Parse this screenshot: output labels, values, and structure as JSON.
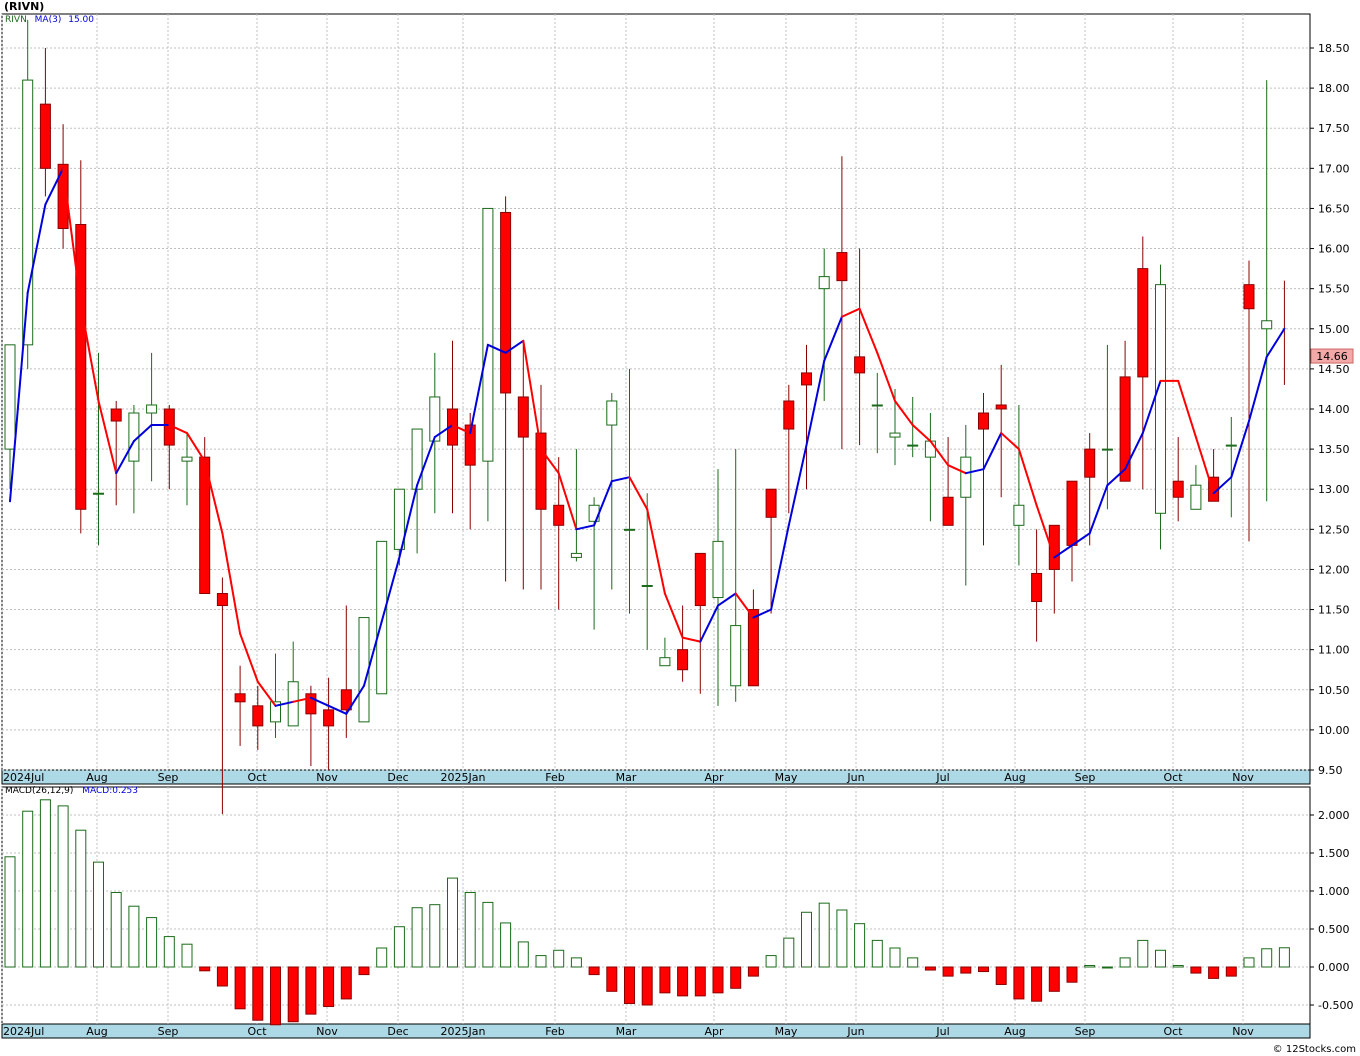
{
  "header": {
    "title": "(RIVN)"
  },
  "price_panel": {
    "legend_symbol": "RIVN",
    "legend_ma": "MA(3)",
    "legend_ma_value": "15.00",
    "last_price_label": "14.66",
    "last_price_value": 14.66,
    "y_ticks": [
      "18.50",
      "18.00",
      "17.50",
      "17.00",
      "16.50",
      "16.00",
      "15.50",
      "15.00",
      "14.50",
      "14.00",
      "13.50",
      "13.00",
      "12.50",
      "12.00",
      "11.50",
      "11.00",
      "10.50",
      "10.00",
      "9.50"
    ],
    "ylim": [
      9.5,
      18.5
    ]
  },
  "macd_panel": {
    "legend_name": "MACD(26,12,9)",
    "legend_value": "MACD:0.253",
    "y_ticks": [
      "2.000",
      "1.500",
      "1.000",
      "0.500",
      "0.000",
      "-0.500"
    ],
    "ylim": [
      -0.75,
      2.25
    ]
  },
  "x_labels": [
    "2024Jul",
    "Aug",
    "Sep",
    "Oct",
    "Nov",
    "Dec",
    "2025Jan",
    "Feb",
    "Mar",
    "Apr",
    "May",
    "Jun",
    "Jul",
    "Aug",
    "Sep",
    "Oct",
    "Nov"
  ],
  "footer": {
    "copyright": "© 12Stocks.com"
  },
  "colors": {
    "up": "#1a6b1a",
    "down": "#ff0000",
    "wick_down": "#8b0000",
    "ma_up": "#0000dd",
    "ma_down": "#ff0000",
    "grid": "#c0c0c0",
    "axis_band": "#add8e6"
  },
  "chart_data": {
    "type": "candlestick",
    "title": "(RIVN)",
    "x": [
      "2024-06-28",
      "2024-07-05",
      "2024-07-12",
      "2024-07-19",
      "2024-07-26",
      "2024-08-02",
      "2024-08-09",
      "2024-08-16",
      "2024-08-23",
      "2024-08-30",
      "2024-09-06",
      "2024-09-13",
      "2024-09-20",
      "2024-09-27",
      "2024-10-04",
      "2024-10-11",
      "2024-10-18",
      "2024-10-25",
      "2024-11-01",
      "2024-11-08",
      "2024-11-15",
      "2024-11-22",
      "2024-11-29",
      "2024-12-06",
      "2024-12-13",
      "2024-12-20",
      "2024-12-27",
      "2025-01-03",
      "2025-01-10",
      "2025-01-17",
      "2025-01-24",
      "2025-01-31",
      "2025-02-07",
      "2025-02-14",
      "2025-02-21",
      "2025-02-28",
      "2025-03-07",
      "2025-03-14",
      "2025-03-21",
      "2025-03-28",
      "2025-04-04",
      "2025-04-11",
      "2025-04-18",
      "2025-04-25",
      "2025-05-02",
      "2025-05-09",
      "2025-05-16",
      "2025-05-23",
      "2025-05-30",
      "2025-06-06",
      "2025-06-13",
      "2025-06-20",
      "2025-06-27",
      "2025-07-03",
      "2025-07-11",
      "2025-07-18",
      "2025-07-25",
      "2025-08-01",
      "2025-08-08",
      "2025-08-15",
      "2025-08-22",
      "2025-08-29",
      "2025-09-05",
      "2025-09-12",
      "2025-09-19",
      "2025-09-26",
      "2025-10-03",
      "2025-10-10",
      "2025-10-17",
      "2025-10-24",
      "2025-10-31",
      "2025-11-07",
      "2025-11-14"
    ],
    "series": [
      {
        "name": "RIVN",
        "open": [
          13.5,
          14.8,
          17.8,
          17.05,
          16.3,
          12.95,
          14.0,
          13.35,
          13.95,
          14.0,
          13.35,
          13.4,
          11.7,
          10.45,
          10.3,
          10.1,
          10.05,
          10.45,
          10.25,
          10.5,
          10.1,
          10.45,
          12.25,
          13.0,
          13.6,
          14.0,
          13.8,
          13.35,
          16.45,
          14.15,
          13.7,
          12.8,
          12.15,
          12.6,
          13.8,
          12.5,
          11.8,
          10.8,
          11.0,
          12.2,
          11.65,
          10.55,
          11.5,
          13.0,
          14.1,
          14.45,
          15.5,
          15.95,
          14.65,
          14.05,
          13.65,
          13.55,
          13.4,
          12.9,
          12.9,
          13.95,
          14.05,
          12.55,
          11.95,
          12.55,
          13.1,
          13.5,
          13.5,
          14.4,
          15.75,
          12.7,
          13.1,
          12.75,
          13.15,
          13.55,
          15.55,
          15.0
        ],
        "high": [
          14.6,
          18.85,
          18.5,
          17.55,
          17.1,
          14.7,
          14.1,
          14.05,
          14.7,
          14.05,
          13.7,
          13.65,
          11.9,
          10.8,
          10.55,
          10.95,
          11.1,
          10.55,
          10.65,
          11.55,
          10.4,
          10.8,
          12.65,
          13.6,
          14.7,
          14.85,
          13.95,
          14.3,
          16.65,
          14.85,
          14.3,
          13.4,
          13.5,
          12.9,
          14.2,
          14.5,
          12.95,
          11.15,
          11.55,
          11.95,
          13.25,
          13.5,
          11.75,
          12.65,
          14.3,
          14.8,
          16.0,
          17.15,
          16.0,
          14.45,
          14.25,
          14.15,
          13.95,
          13.65,
          13.8,
          14.2,
          14.55,
          14.05,
          12.5,
          12.3,
          13.1,
          13.7,
          14.8,
          14.85,
          16.15,
          15.8,
          13.65,
          13.3,
          13.5,
          13.9,
          15.85,
          18.1,
          15.6
        ],
        "low": [
          13.0,
          14.5,
          16.65,
          16.0,
          12.45,
          12.3,
          12.8,
          12.7,
          13.1,
          13.0,
          12.8,
          11.75,
          8.95,
          9.8,
          9.75,
          9.9,
          10.05,
          9.55,
          9.5,
          9.9,
          10.25,
          10.6,
          12.05,
          12.2,
          12.7,
          12.7,
          12.5,
          12.6,
          11.85,
          11.75,
          11.75,
          11.5,
          12.1,
          11.25,
          11.75,
          11.45,
          11.0,
          10.8,
          10.6,
          10.45,
          10.3,
          10.35,
          10.85,
          11.45,
          12.7,
          13.0,
          14.1,
          13.5,
          13.55,
          13.45,
          13.3,
          13.4,
          12.6,
          12.9,
          11.8,
          12.3,
          12.9,
          12.05,
          11.1,
          11.45,
          11.85,
          12.3,
          12.75,
          13.3,
          13.0,
          12.25,
          12.6,
          12.8,
          12.95,
          12.65,
          12.35,
          12.85,
          14.3
        ],
        "close": [
          14.8,
          18.1,
          17.0,
          16.25,
          12.75,
          12.95,
          13.85,
          13.95,
          14.05,
          13.55,
          13.4,
          11.7,
          11.55,
          10.35,
          10.05,
          10.35,
          10.6,
          10.2,
          10.05,
          10.25,
          11.4,
          12.35,
          13.0,
          13.75,
          14.15,
          13.55,
          13.3,
          16.5,
          14.2,
          13.65,
          12.75,
          12.55,
          12.2,
          12.8,
          14.1,
          12.5,
          11.8,
          10.9,
          10.75,
          11.55,
          12.35,
          11.3,
          10.55,
          12.65,
          13.75,
          14.3,
          15.65,
          15.6,
          14.45,
          14.05,
          13.7,
          13.55,
          13.6,
          12.55,
          13.4,
          13.75,
          14.0,
          12.8,
          11.6,
          12.0,
          12.3,
          13.15,
          13.5,
          13.1,
          14.4,
          15.55,
          12.9,
          13.05,
          12.85,
          13.55,
          15.25,
          15.1,
          14.66
        ]
      },
      {
        "name": "MA(3)",
        "values": [
          12.85,
          15.45,
          16.55,
          17.0,
          15.3,
          14.1,
          13.2,
          13.6,
          13.8,
          13.8,
          13.7,
          13.35,
          12.45,
          11.2,
          10.6,
          10.3,
          10.35,
          10.4,
          10.3,
          10.2,
          10.55,
          11.35,
          12.15,
          13.05,
          13.65,
          13.8,
          13.7,
          14.8,
          14.7,
          14.85,
          13.5,
          13.2,
          12.5,
          12.55,
          13.1,
          13.15,
          12.75,
          11.7,
          11.15,
          11.1,
          11.55,
          11.7,
          11.4,
          11.5,
          12.55,
          13.55,
          14.6,
          15.15,
          15.25,
          14.7,
          14.1,
          13.8,
          13.6,
          13.3,
          13.2,
          13.25,
          13.7,
          13.5,
          12.8,
          12.15,
          12.3,
          12.45,
          13.05,
          13.25,
          13.7,
          14.35,
          14.35,
          13.65,
          12.95,
          13.15,
          13.85,
          14.65,
          15.0
        ],
        "direction": [
          "up",
          "up",
          "up",
          "up",
          "down",
          "down",
          "down",
          "up",
          "up",
          "up",
          "down",
          "down",
          "down",
          "down",
          "down",
          "down",
          "up",
          "down",
          "up",
          "up",
          "up",
          "up",
          "up",
          "up",
          "up",
          "up",
          "down",
          "up",
          "up",
          "up",
          "down",
          "down",
          "down",
          "up",
          "up",
          "up",
          "down",
          "down",
          "down",
          "down",
          "up",
          "up",
          "down",
          "up",
          "up",
          "up",
          "up",
          "up",
          "down",
          "down",
          "down",
          "down",
          "down",
          "down",
          "down",
          "up",
          "up",
          "down",
          "down",
          "down",
          "up",
          "up",
          "up",
          "up",
          "up",
          "up",
          "down",
          "down",
          "down",
          "up",
          "up",
          "up",
          "up"
        ]
      },
      {
        "name": "MACD(26,12,9)",
        "values": [
          1.45,
          2.05,
          2.2,
          2.12,
          1.8,
          1.38,
          0.98,
          0.8,
          0.65,
          0.4,
          0.3,
          -0.05,
          -0.25,
          -0.55,
          -0.7,
          -0.76,
          -0.72,
          -0.62,
          -0.52,
          -0.42,
          -0.1,
          0.25,
          0.53,
          0.78,
          0.82,
          1.17,
          0.98,
          0.85,
          0.58,
          0.33,
          0.15,
          0.22,
          0.12,
          -0.1,
          -0.32,
          -0.48,
          -0.5,
          -0.34,
          -0.38,
          -0.38,
          -0.34,
          -0.28,
          -0.12,
          0.15,
          0.38,
          0.72,
          0.84,
          0.75,
          0.57,
          0.35,
          0.25,
          0.12,
          -0.04,
          -0.12,
          -0.08,
          -0.06,
          -0.23,
          -0.42,
          -0.45,
          -0.32,
          -0.2,
          0.02,
          0.0,
          0.12,
          0.35,
          0.22,
          0.02,
          -0.08,
          -0.15,
          -0.12,
          0.12,
          0.24,
          0.253
        ]
      }
    ]
  }
}
